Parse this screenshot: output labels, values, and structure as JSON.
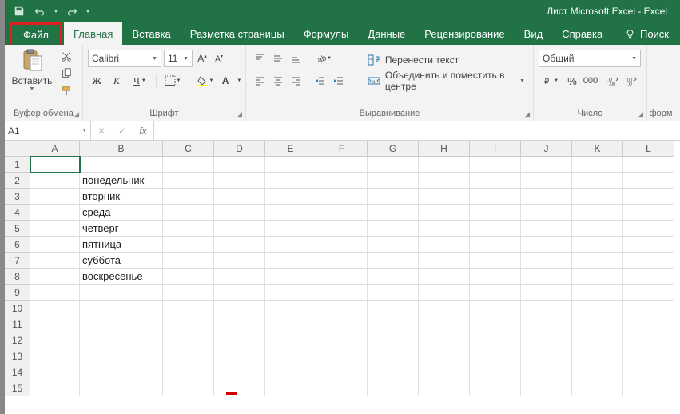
{
  "title": "Лист Microsoft Excel  -  Excel",
  "qat": {
    "save": "save",
    "undo": "undo",
    "redo": "redo"
  },
  "tabs": {
    "file": "Файл",
    "items": [
      "Главная",
      "Вставка",
      "Разметка страницы",
      "Формулы",
      "Данные",
      "Рецензирование",
      "Вид",
      "Справка"
    ],
    "active_index": 0,
    "search": "Поиск"
  },
  "ribbon": {
    "clipboard": {
      "paste": "Вставить",
      "label": "Буфер обмена"
    },
    "font": {
      "name": "Calibri",
      "size": "11",
      "bold": "Ж",
      "italic": "К",
      "underline": "Ч",
      "label": "Шрифт"
    },
    "alignment": {
      "wrap": "Перенести текст",
      "merge": "Объединить и поместить в центре",
      "label": "Выравнивание"
    },
    "number": {
      "format": "Общий",
      "label": "Число"
    },
    "more": "форм"
  },
  "namebox": "A1",
  "fx_label": "fx",
  "columns": [
    "A",
    "B",
    "C",
    "D",
    "E",
    "F",
    "G",
    "H",
    "I",
    "J",
    "K",
    "L"
  ],
  "rows": [
    1,
    2,
    3,
    4,
    5,
    6,
    7,
    8,
    9,
    10,
    11,
    12,
    13,
    14,
    15
  ],
  "cells": {
    "B2": "понедельник",
    "B3": "вторник",
    "B4": "среда",
    "B5": "четверг",
    "B6": "пятница",
    "B7": "суббота",
    "B8": "воскресенье"
  },
  "selected_cell": "A1",
  "colors": {
    "brand": "#217346",
    "highlight": "#e02020"
  }
}
